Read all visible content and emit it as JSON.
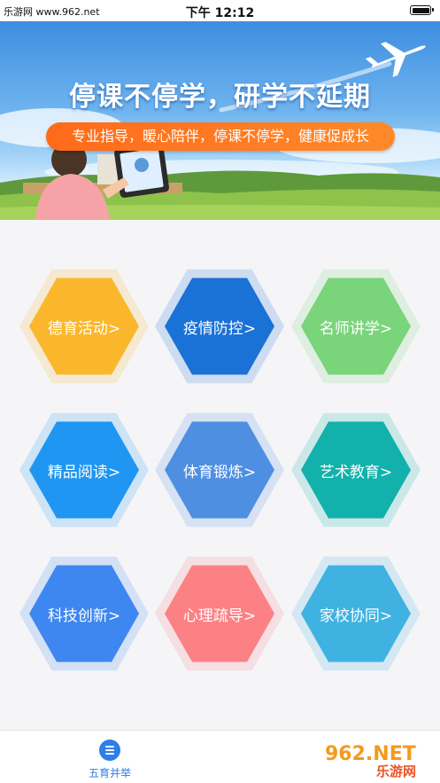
{
  "status_bar": {
    "left_text": "乐游网 www.962.net",
    "time": "下午 12:12"
  },
  "banner": {
    "title": "停课不停学，研学不延期",
    "subtitle": "专业指导，暖心陪伴，停课不停学，健康促成长"
  },
  "grid": {
    "items": [
      {
        "label": "德育活动>",
        "color": "#fbb72c"
      },
      {
        "label": "疫情防控>",
        "color": "#1a71d6"
      },
      {
        "label": "名师讲学>",
        "color": "#79d47a"
      },
      {
        "label": "精品阅读>",
        "color": "#1e96f2"
      },
      {
        "label": "体育锻炼>",
        "color": "#4f8fe2"
      },
      {
        "label": "艺术教育>",
        "color": "#12b1ab"
      },
      {
        "label": "科技创新>",
        "color": "#3e86f0"
      },
      {
        "label": "心理疏导>",
        "color": "#fb8184"
      },
      {
        "label": "家校协同>",
        "color": "#3fb2e2"
      }
    ]
  },
  "tab_bar": {
    "items": [
      {
        "label": "五育并举",
        "icon": "menu-icon",
        "active": true
      }
    ],
    "active_color": "#2f7ee6"
  },
  "watermark": {
    "logo_text": "962.NET",
    "site_text": "乐游网"
  }
}
